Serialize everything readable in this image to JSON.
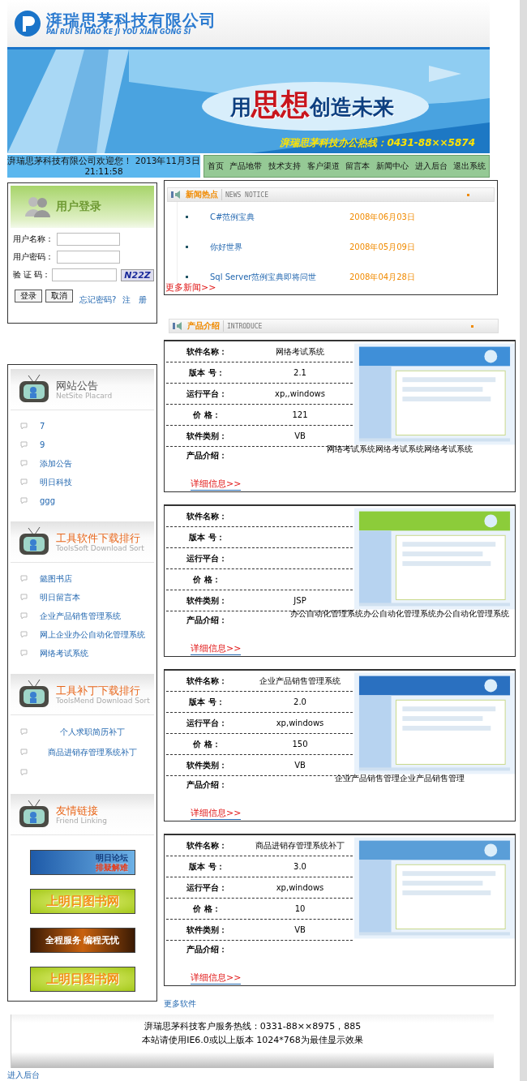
{
  "header": {
    "company": "湃瑞思茅科技有限公司",
    "pinyin": "PAI RUI SI MAO KE JI YOU XIAN GONG SI"
  },
  "banner": {
    "slogan": "用**思想**创造未来",
    "hotline": "湃瑞思茅科技办公热线：0431-88××5874"
  },
  "welcome": {
    "text": "湃瑞思茅科技有限公司欢迎您！ 2013年11月3日",
    "time": "21:11:58"
  },
  "nav": [
    "首页",
    "产品地带",
    "技术支持",
    "客户渠道",
    "留言本",
    "新闻中心",
    "进入后台",
    "退出系统"
  ],
  "login": {
    "title": "用户登录",
    "fields": [
      {
        "label": "用户名称：",
        "kind": "text"
      },
      {
        "label": "用户密码：",
        "kind": "password"
      },
      {
        "label": "验 证 码：",
        "kind": "captcha",
        "captcha": "N22Z"
      }
    ],
    "buttons": [
      "登录",
      "取消"
    ],
    "links": [
      "忘记密码?",
      "注　册"
    ]
  },
  "news": {
    "title": "新闻热点",
    "subtitle": "NEWS NOTICE",
    "items": [
      {
        "title": "C#范例宝典",
        "date": "2008年06月03日"
      },
      {
        "title": "你好世界",
        "date": "2008年05月09日"
      },
      {
        "title": "Sql Server范例宝典即将问世",
        "date": "2008年04月28日"
      }
    ],
    "more": "更多新闻>>"
  },
  "intro": {
    "title": "产品介绍",
    "subtitle": "INTRODUCE"
  },
  "products": [
    {
      "fields": [
        {
          "label": "软件名称：",
          "value": "网络考试系统"
        },
        {
          "label": "版本 号：",
          "value": "2.1"
        },
        {
          "label": "运行平台：",
          "value": "xp,,windows"
        },
        {
          "label": "价 格：",
          "value": "121"
        },
        {
          "label": "软件类别：",
          "value": "VB"
        }
      ],
      "intro_label": "产品介绍：",
      "description": "网络考试系统网络考试系统网络考试系统",
      "details": "详细信息>>"
    },
    {
      "fields": [
        {
          "label": "软件名称："
        },
        {
          "label": "版本 号："
        },
        {
          "label": "运行平台："
        },
        {
          "label": "价 格："
        },
        {
          "label": "软件类别：",
          "value": "JSP"
        }
      ],
      "intro_label": "产品介绍：",
      "description": "办公自动化管理系统办公自动化管理系统办公自动化管理系统",
      "details": "详细信息>>"
    },
    {
      "fields": [
        {
          "label": "软件名称：",
          "value": "企业产品销售管理系统"
        },
        {
          "label": "版本 号：",
          "value": "2.0"
        },
        {
          "label": "运行平台：",
          "value": "xp,windows"
        },
        {
          "label": "价 格：",
          "value": "150"
        },
        {
          "label": "软件类别：",
          "value": "VB"
        }
      ],
      "intro_label": "产品介绍：",
      "description": "企业产品销售管理企业产品销售管理",
      "details": "详细信息>>"
    },
    {
      "fields": [
        {
          "label": "软件名称：",
          "value": "商品进销存管理系统补丁"
        },
        {
          "label": "版本 号：",
          "value": "3.0"
        },
        {
          "label": "运行平台：",
          "value": "xp,windows"
        },
        {
          "label": "价 格：",
          "value": "10"
        },
        {
          "label": "软件类别：",
          "value": "VB"
        }
      ],
      "intro_label": "产品介绍：",
      "details": "详细信息>>"
    }
  ],
  "more_software": "更多软件",
  "sidebar": [
    {
      "kind": "list",
      "title": "网站公告",
      "subtitle": "NetSite Placard",
      "color": "#555555",
      "items": [
        "7",
        "9",
        "添加公告",
        "明日科技",
        "ggg"
      ]
    },
    {
      "kind": "list",
      "title": "工具软件下载排行",
      "subtitle": "ToolsSoft Download Sort",
      "color": "#e8661a",
      "items": [
        "懿图书店",
        "明日留言本",
        "企业产品销售管理系统",
        "网上企业办公自动化管理系统",
        "网络考试系统"
      ]
    },
    {
      "kind": "centered",
      "title": "工具补丁下载排行",
      "subtitle": "ToolsMend Download Sort",
      "color": "#e8661a",
      "items": [
        "个人求职简历补丁",
        "商品进销存管理系统补丁"
      ]
    },
    {
      "kind": "banners",
      "title": "友情链接",
      "subtitle": "Friend Linking",
      "color": "#e8661a",
      "banners": [
        {
          "kind": "forum",
          "lines": [
            "明日论坛",
            "排疑解难"
          ]
        },
        {
          "kind": "book",
          "lines": [
            "上明日图书网"
          ]
        },
        {
          "kind": "service",
          "lines": [
            "全程服务 编程无忧"
          ]
        },
        {
          "kind": "book",
          "lines": [
            "上明日图书网"
          ]
        }
      ]
    }
  ],
  "footer": {
    "lines": [
      "湃瑞思茅科技客户服务热线：0331-88××8975，885",
      "本站请使用IE6.0或以上版本 1024*768为最佳显示效果"
    ]
  },
  "admin_link": "进入后台"
}
